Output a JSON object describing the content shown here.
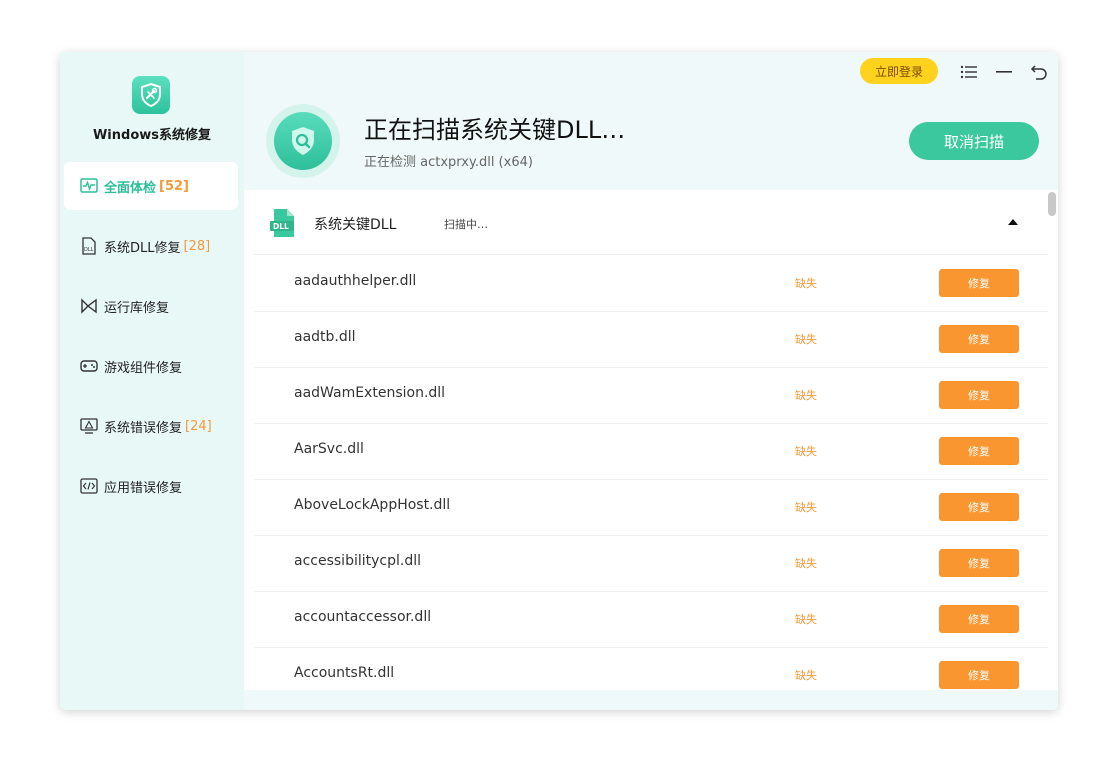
{
  "app": {
    "title": "Windows系统修复"
  },
  "sidebar": {
    "items": [
      {
        "label": "全面体检",
        "count": "[52]",
        "icon": "heartbeat-icon",
        "active": true
      },
      {
        "label": "系统DLL修复",
        "count": "[28]",
        "icon": "dll-file-icon"
      },
      {
        "label": "运行库修复",
        "count": "",
        "icon": "runtime-icon"
      },
      {
        "label": "游戏组件修复",
        "count": "",
        "icon": "gamepad-icon"
      },
      {
        "label": "系统错误修复",
        "count": "[24]",
        "icon": "monitor-warning-icon"
      },
      {
        "label": "应用错误修复",
        "count": "",
        "icon": "code-window-icon"
      }
    ]
  },
  "topbar": {
    "login_label": "立即登录"
  },
  "header": {
    "title": "正在扫描系统关键DLL…",
    "subtitle": "正在检测 actxprxy.dll (x64)",
    "cancel_label": "取消扫描"
  },
  "group": {
    "title": "系统关键DLL",
    "status": "扫描中…",
    "icon_text": "DLL"
  },
  "rows": [
    {
      "name": "aadauthhelper.dll",
      "status": "缺失",
      "action": "修复"
    },
    {
      "name": "aadtb.dll",
      "status": "缺失",
      "action": "修复"
    },
    {
      "name": "aadWamExtension.dll",
      "status": "缺失",
      "action": "修复"
    },
    {
      "name": "AarSvc.dll",
      "status": "缺失",
      "action": "修复"
    },
    {
      "name": "AboveLockAppHost.dll",
      "status": "缺失",
      "action": "修复"
    },
    {
      "name": "accessibilitycpl.dll",
      "status": "缺失",
      "action": "修复"
    },
    {
      "name": "accountaccessor.dll",
      "status": "缺失",
      "action": "修复"
    },
    {
      "name": "AccountsRt.dll",
      "status": "缺失",
      "action": "修复"
    }
  ],
  "colors": {
    "accent": "#3cc89e",
    "warning": "#f39a3a",
    "fix_button": "#fa9630",
    "login": "#ffd21e"
  }
}
